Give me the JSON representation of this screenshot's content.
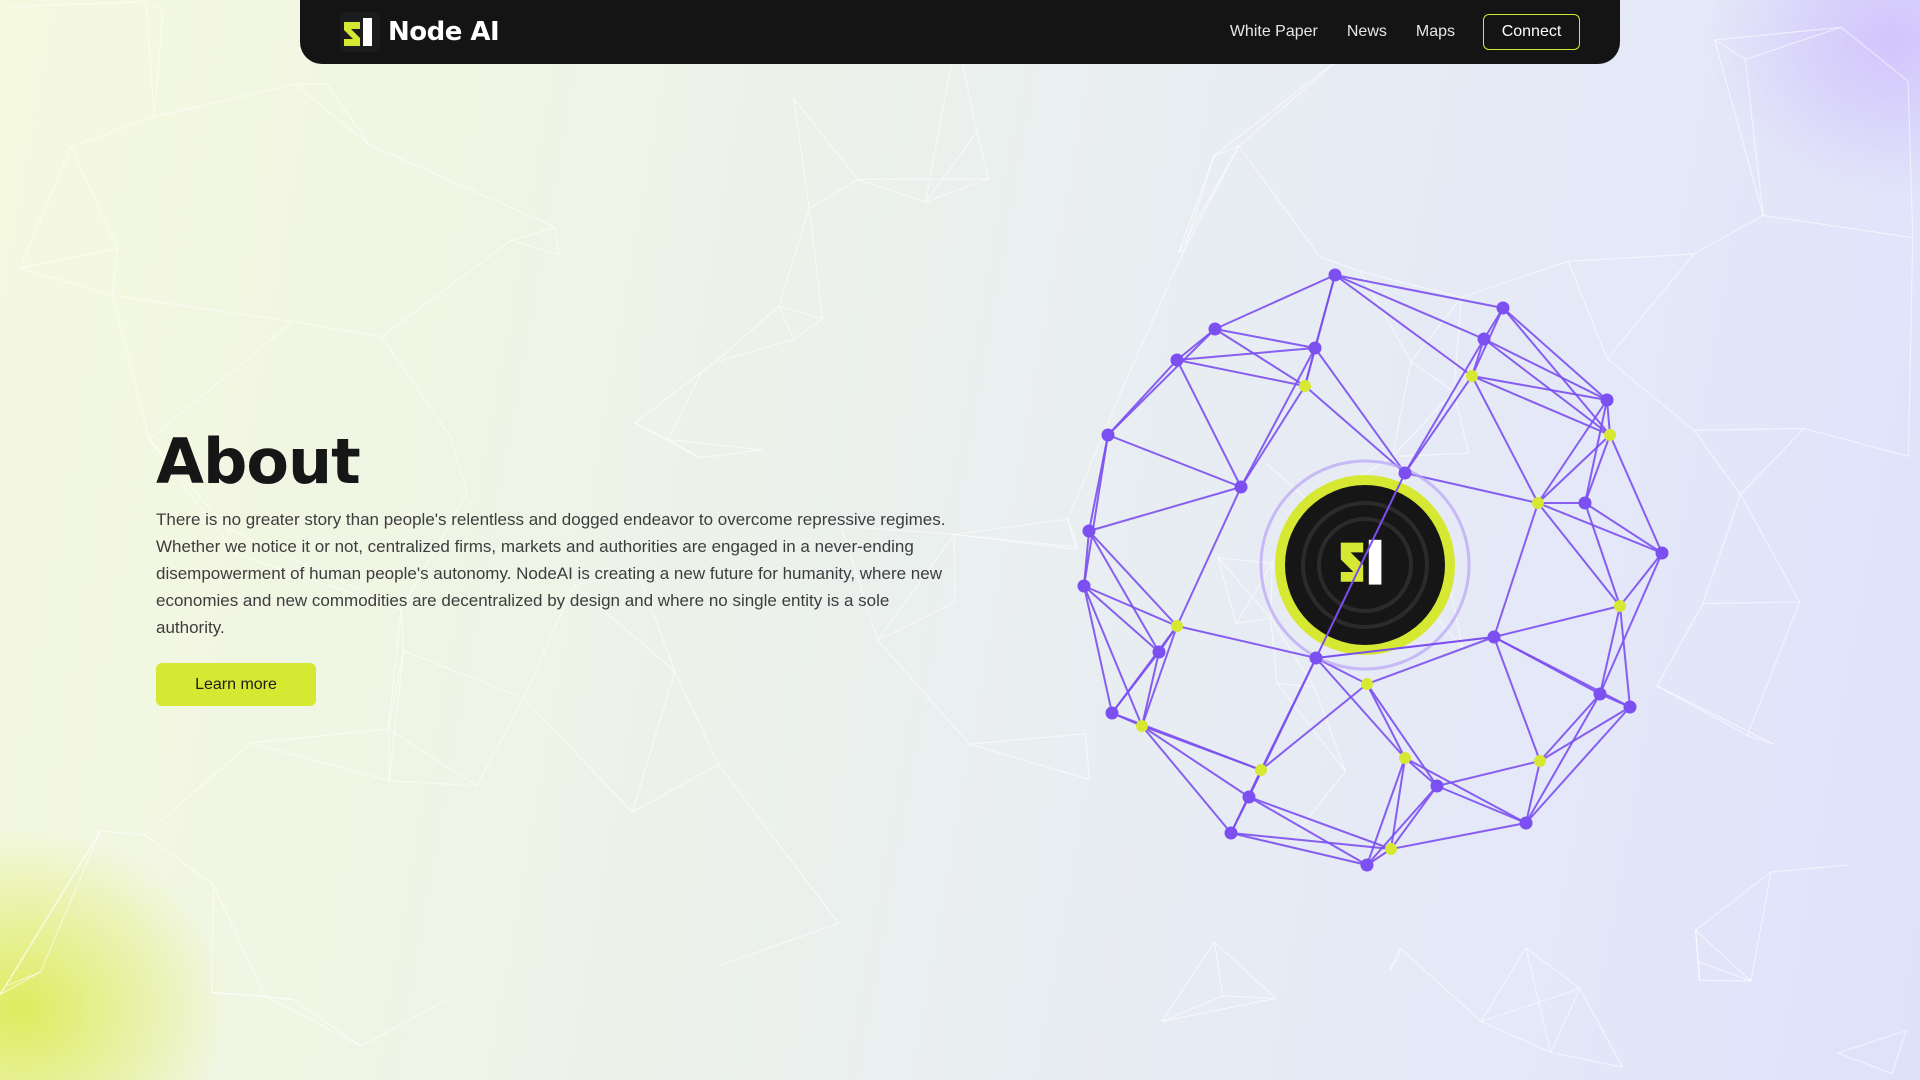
{
  "colors": {
    "accent": "#d6e832",
    "navbar": "#141414",
    "network_purple": "#7b4ff0",
    "node_yellow": "#d6e832"
  },
  "navbar": {
    "brand_name": "Node AI",
    "logo_icon": "node-ai-logo",
    "links": [
      {
        "label": "White Paper"
      },
      {
        "label": "News"
      },
      {
        "label": "Maps"
      }
    ],
    "connect_label": "Connect"
  },
  "about": {
    "title": "About",
    "text": "There is no greater story than people's relentless and dogged endeavor to overcome repressive regimes. Whether we notice it or not, centralized firms, markets and authorities are engaged in a never-ending disempowerment of human people's autonomy. NodeAI is creating a new future for humanity, where new economies and new commodities are decentralized by design and where no single entity is a sole authority.",
    "button_label": "Learn more"
  },
  "hero_graphic": {
    "icon": "network-sphere",
    "center_icon": "node-ai-logo"
  }
}
